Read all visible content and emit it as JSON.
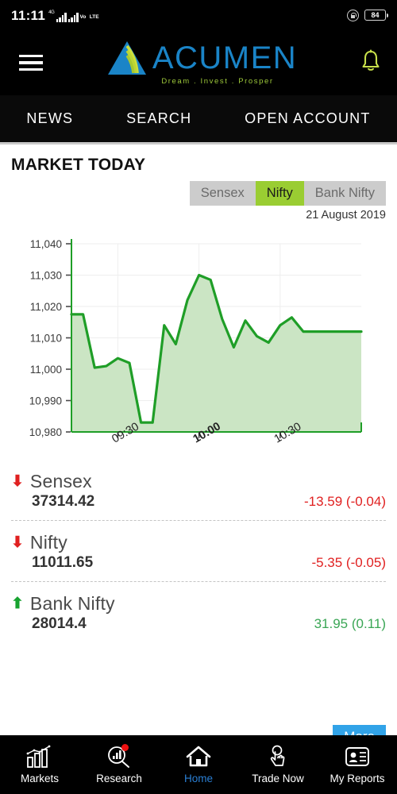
{
  "statusbar": {
    "time": "11:11",
    "network_sup": "4G",
    "volte_line1": "Vo",
    "volte_line2": "LTE",
    "battery": "84",
    "lock_icon": "lock-rotation-icon"
  },
  "header": {
    "menu_icon": "hamburger-menu-icon",
    "logo_text": "ACUMEN",
    "tagline": "Dream  .  Invest  .  Prosper",
    "bell_icon": "notification-bell-icon",
    "logo_blue": "#1a84c7",
    "logo_green": "#9ec93a"
  },
  "topnav": {
    "items": [
      {
        "label": "NEWS"
      },
      {
        "label": "SEARCH"
      },
      {
        "label": "OPEN ACCOUNT"
      }
    ]
  },
  "market": {
    "title": "MARKET TODAY",
    "tabs": [
      {
        "label": "Sensex",
        "active": false
      },
      {
        "label": "Nifty",
        "active": true
      },
      {
        "label": "Bank Nifty",
        "active": false
      }
    ],
    "date": "21 August 2019",
    "active_color": "#9acd32"
  },
  "chart_data": {
    "type": "area",
    "title": "",
    "xlabel": "",
    "ylabel": "",
    "series_name": "Nifty",
    "ylim": [
      10980,
      11040
    ],
    "ytick_labels": [
      "11,040",
      "11,030",
      "11,020",
      "11,010",
      "11,000",
      "10,990",
      "10,980"
    ],
    "yticks": [
      11040,
      11030,
      11020,
      11010,
      11000,
      10990,
      10980
    ],
    "xtick_labels": [
      "09:30",
      "10:00",
      "10:30"
    ],
    "xtick_bold": [
      "10:00"
    ],
    "grid": true,
    "line_color": "#1f9e27",
    "fill_color": "#cbe5c4",
    "x": [
      0,
      1,
      2,
      3,
      4,
      5,
      6,
      7,
      8,
      9,
      10,
      11,
      12,
      13,
      14,
      15,
      16,
      17,
      18,
      19,
      20,
      21,
      22,
      23,
      24,
      25
    ],
    "values": [
      11017.5,
      11017.5,
      11000.5,
      11001.0,
      11003.5,
      11002.0,
      10983.0,
      10983.0,
      11014.0,
      11008.0,
      11022.0,
      11030.0,
      11028.5,
      11016.0,
      11007.0,
      11015.5,
      11010.5,
      11008.5,
      11014.0,
      11016.5,
      11012.0,
      11012.0,
      11012.0,
      11012.0,
      11012.0,
      11012.0
    ]
  },
  "indices": [
    {
      "name": "Sensex",
      "value": "37314.42",
      "change": "-13.59 (-0.04)",
      "direction": "down",
      "arrow": "arrow-down-icon"
    },
    {
      "name": "Nifty",
      "value": "11011.65",
      "change": "-5.35 (-0.05)",
      "direction": "down",
      "arrow": "arrow-down-icon"
    },
    {
      "name": "Bank Nifty",
      "value": "28014.4",
      "change": "31.95 (0.11)",
      "direction": "up",
      "arrow": "arrow-up-icon"
    }
  ],
  "more_button": {
    "label": "More",
    "color": "#31a3e8"
  },
  "bottomnav": {
    "items": [
      {
        "label": "Markets",
        "icon": "bar-chart-trend-icon",
        "active": false,
        "badge": false
      },
      {
        "label": "Research",
        "icon": "magnifier-chart-icon",
        "active": false,
        "badge": true
      },
      {
        "label": "Home",
        "icon": "home-icon",
        "active": true,
        "badge": false
      },
      {
        "label": "Trade Now",
        "icon": "tap-finger-icon",
        "active": false,
        "badge": false
      },
      {
        "label": "My Reports",
        "icon": "id-card-icon",
        "active": false,
        "badge": false
      }
    ],
    "active_color": "#2a7fd4"
  }
}
